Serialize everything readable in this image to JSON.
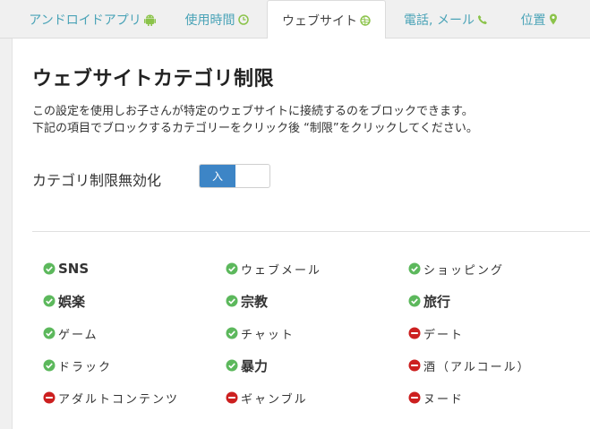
{
  "tabs": [
    {
      "label": "アンドロイドアプリ",
      "icon": "android-icon"
    },
    {
      "label": "使用時間",
      "icon": "clock-icon"
    },
    {
      "label": "ウェブサイト",
      "icon": "globe-icon",
      "active": true
    },
    {
      "label": "電話, メール",
      "icon": "phone-icon"
    },
    {
      "label": "位置",
      "icon": "location-pin-icon"
    }
  ],
  "page": {
    "title": "ウェブサイトカテゴリ制限",
    "desc1": "この設定を使用しお子さんが特定のウェブサイトに接続するのをブロックできます。",
    "desc2": "下記の項目でブロックするカテゴリーをクリック後 “制限”をクリックしてください。"
  },
  "toggle": {
    "label": "カテゴリ制限無効化",
    "state_label": "入"
  },
  "categories": [
    {
      "label": "SNS",
      "status": "allowed"
    },
    {
      "label": "ウェブメール",
      "status": "allowed"
    },
    {
      "label": "ショッピング",
      "status": "allowed"
    },
    {
      "label": "娯楽",
      "status": "allowed"
    },
    {
      "label": "宗教",
      "status": "allowed"
    },
    {
      "label": "旅行",
      "status": "allowed"
    },
    {
      "label": "ゲーム",
      "status": "allowed"
    },
    {
      "label": "チャット",
      "status": "allowed"
    },
    {
      "label": "デート",
      "status": "blocked"
    },
    {
      "label": "ドラック",
      "status": "allowed"
    },
    {
      "label": "暴力",
      "status": "allowed"
    },
    {
      "label": "酒（アルコール）",
      "status": "blocked"
    },
    {
      "label": "アダルトコンテンツ",
      "status": "blocked"
    },
    {
      "label": "ギャンブル",
      "status": "blocked"
    },
    {
      "label": "ヌード",
      "status": "blocked"
    }
  ],
  "colors": {
    "accent": "#4aa3b7",
    "allowed": "#5cb85c",
    "blocked": "#cc1f1f",
    "toggle_on": "#3d85c6"
  }
}
